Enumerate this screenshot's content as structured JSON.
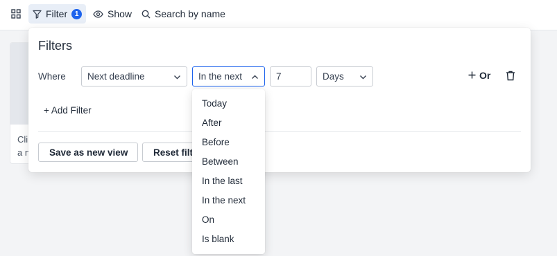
{
  "toolbar": {
    "grid_icon": "grid-icon",
    "filter_label": "Filter",
    "filter_count": "1",
    "show_label": "Show",
    "search_label": "Search by name"
  },
  "background_card": {
    "text_line1": "Cli",
    "text_line2": "a n"
  },
  "filter_panel": {
    "title": "Filters",
    "where_label": "Where",
    "field_value": "Next deadline",
    "operator_value": "In the next",
    "amount_value": "7",
    "unit_value": "Days",
    "or_label": "Or",
    "add_filter_label": "+ Add Filter",
    "save_view_label": "Save as new view",
    "reset_label": "Reset filters"
  },
  "operator_options": [
    "Today",
    "After",
    "Before",
    "Between",
    "In the last",
    "In the next",
    "On",
    "Is blank"
  ],
  "colors": {
    "accent": "#1d63ed",
    "toolbar_active_bg": "#e8eef7",
    "page_bg": "#f3f4f6"
  }
}
